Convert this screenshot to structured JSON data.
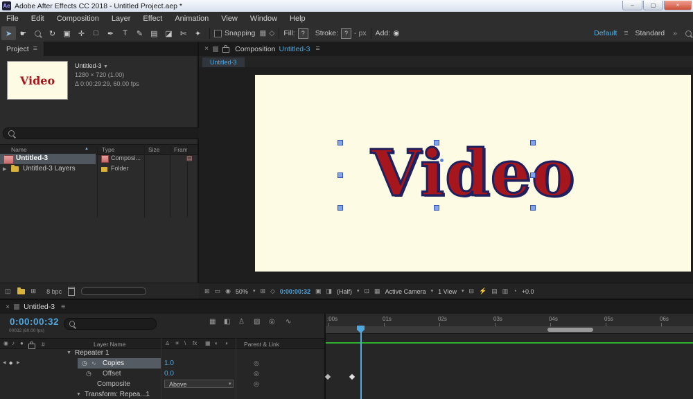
{
  "colors": {
    "accent": "#4fa8e0",
    "canvas": "#fdfbe3",
    "video_fill": "#a6161d",
    "video_outline": "#20205e",
    "selection_row": "#50575e",
    "green_bar": "#2fae2f"
  },
  "titlebar": {
    "icon": "Ae",
    "title": "Adobe After Effects CC 2018 - Untitled Project.aep *"
  },
  "menubar": {
    "items": [
      "File",
      "Edit",
      "Composition",
      "Layer",
      "Effect",
      "Animation",
      "View",
      "Window",
      "Help"
    ]
  },
  "toolbar": {
    "snapping": "Snapping",
    "fill_label": "Fill:",
    "fill_value": "?",
    "stroke_label": "Stroke:",
    "stroke_value": "?",
    "stroke_width": "-",
    "px": "px",
    "add_label": "Add:",
    "workspace_active": "Default",
    "workspace_other": "Standard"
  },
  "project": {
    "tab": "Project",
    "thumb_text": "Video",
    "item_name": "Untitled-3",
    "item_res": "1280 × 720 (1.00)",
    "item_time": "Δ 0:00:29:29, 60.00 fps",
    "col_name": "Name",
    "col_type": "Type",
    "col_size": "Size",
    "col_frame": "Fram",
    "rows": [
      {
        "name": "Untitled-3",
        "type": "Composi..."
      },
      {
        "name": "Untitled-3 Layers",
        "type": "Folder"
      }
    ],
    "bpc": "8 bpc"
  },
  "comp": {
    "tab_prefix": "Composition",
    "tab_name": "Untitled-3",
    "subtab": "Untitled-3",
    "canvas_text": "Video",
    "zoom": "50%",
    "time": "0:00:00:32",
    "resolution": "(Half)",
    "camera": "Active Camera",
    "view": "1 View",
    "exposure": "+0.0"
  },
  "timeline": {
    "tab": "Untitled-3",
    "time": "0:00:00:32",
    "time_sub": "00032 (60.00 fps)",
    "col_num": "#",
    "col_layer": "Layer Name",
    "col_parent": "Parent & Link",
    "repeater": "Repeater 1",
    "copies": "Copies",
    "copies_value": "1.0",
    "offset": "Offset",
    "offset_value": "0.0",
    "composite": "Composite",
    "composite_value": "Above",
    "transform": "Transform: Repea...1",
    "ruler": [
      ":00s",
      "01s",
      "02s",
      "03s",
      "04s",
      "05s",
      "06s"
    ]
  },
  "icons": {
    "menu": "≡",
    "close": "×",
    "overflow": "»",
    "dd": "▾",
    "win_min": "–",
    "win_max": "▢",
    "win_close": "×",
    "t_sel": "➤",
    "t_hand": "☛",
    "t_rot": "↻",
    "t_cam": "▣",
    "t_pan": "✛",
    "t_shape": "□",
    "t_pen": "✒",
    "t_type": "T",
    "t_brush": "✎",
    "t_clone": "▤",
    "t_eraser": "◪",
    "t_roto": "✄",
    "t_puppet": "✦",
    "snap_a": "▦",
    "snap_b": "◇",
    "add": "◉",
    "sort": "▲",
    "tw_o": "▼",
    "tw_c": "▶",
    "stopwatch": "◷",
    "pick": "◎",
    "graphmini": "∿",
    "eye": "◉",
    "audio": "♪",
    "solo": "●",
    "kf_prev": "◀",
    "kf_next": "▶",
    "kf": "◆",
    "tl_flow": "▦",
    "tl_draft": "◧",
    "tl_shy": "♙",
    "tl_blend": "▧",
    "tl_mblur": "◎",
    "tl_graph": "∿",
    "sw_shy": "♙",
    "sw_sun": "☀",
    "sw_quality": "\\",
    "sw_fx": "fx",
    "sw_blend": "▦",
    "sw_mblur": "◐",
    "sw_adj": "◑",
    "cf_flow": "⊞",
    "cf_disp": "▭",
    "cf_chan": "◉",
    "cf_grid": "⊞",
    "cf_mask": "◇",
    "cf_snap": "▣",
    "cf_show": "◨",
    "cf_roi": "⊡",
    "cf_tgrid": "▦",
    "cf_pix": "⊟",
    "cf_fast": "⚡",
    "cf_mini": "▤",
    "cf_flow2": "▥",
    "cf_exp": "◔",
    "pf_interpret": "◫",
    "pf_newcomp": "⊞",
    "film": "▤"
  }
}
